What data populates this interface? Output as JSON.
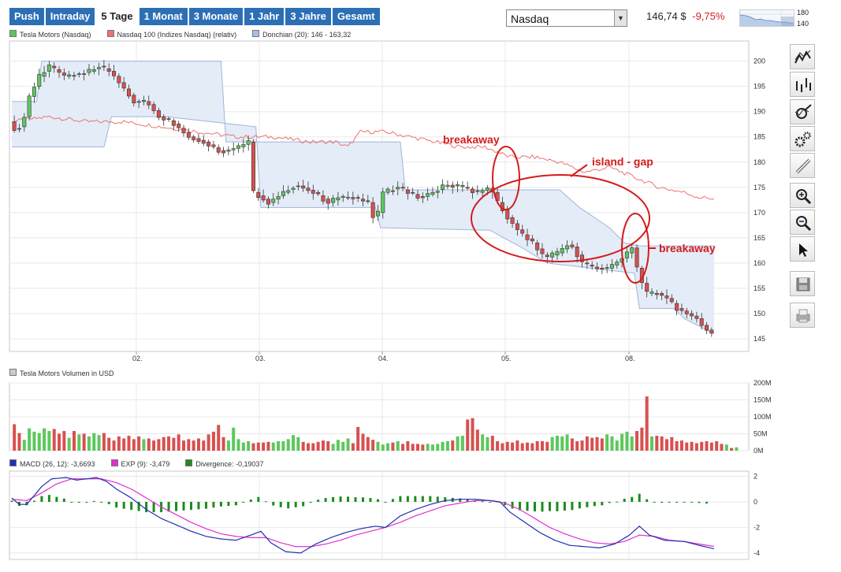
{
  "tabs": [
    {
      "label": "Push",
      "active": false
    },
    {
      "label": "Intraday",
      "active": false
    },
    {
      "label": "5 Tage",
      "active": true
    },
    {
      "label": "1 Monat",
      "active": false
    },
    {
      "label": "3 Monate",
      "active": false
    },
    {
      "label": "1 Jahr",
      "active": false
    },
    {
      "label": "3 Jahre",
      "active": false
    },
    {
      "label": "Gesamt",
      "active": false
    }
  ],
  "exchange_select": {
    "value": "Nasdaq"
  },
  "quote": {
    "price": "146,74 $",
    "change": "-9,75%"
  },
  "mini_chart": {
    "tick_high": "180",
    "tick_low": "140"
  },
  "colors": {
    "up": "#5cc85c",
    "down": "#d85050",
    "index_line": "#f07070",
    "donchian_fill": "#e4ecf8",
    "donchian_line": "#9fb6d8",
    "macd": "#2030b0",
    "signal": "#e030d0",
    "divergence": "#1e8a1e",
    "accent": "#2c6fb5",
    "annotation": "#d41c1c"
  },
  "legend_price": [
    {
      "label": "Tesla Motors (Nasdaq)",
      "color": "#5cc85c"
    },
    {
      "label": "Nasdaq 100 (Indizes Nasdaq) (relativ)",
      "color": "#f07070"
    },
    {
      "label": "Donchian (20): 146 - 163,32",
      "color": "#a9bfe0"
    }
  ],
  "legend_volume": [
    {
      "label": "Tesla Motors Volumen in USD",
      "color": "#cccccc"
    }
  ],
  "legend_macd": [
    {
      "label": "MACD (26, 12): -3,6693",
      "color": "#2030b0"
    },
    {
      "label": "EXP (9): -3,479",
      "color": "#e030d0"
    },
    {
      "label": "Divergence: -0,19037",
      "color": "#1e8a1e"
    }
  ],
  "annotations": {
    "breakaway_1": "breakaway",
    "island_gap": "island - gap",
    "breakaway_2": "breakaway"
  },
  "toolbar": [
    {
      "name": "line-chart-icon"
    },
    {
      "name": "ohlc-chart-icon"
    },
    {
      "name": "indicator-icon"
    },
    {
      "name": "settings-icon"
    },
    {
      "name": "drawing-tool-icon"
    },
    {
      "name": "zoom-in-icon"
    },
    {
      "name": "zoom-out-icon"
    },
    {
      "name": "pointer-icon"
    },
    {
      "name": "save-icon"
    },
    {
      "name": "print-icon"
    }
  ],
  "chart_data": [
    {
      "type": "candlestick",
      "title": "Tesla Motors (Nasdaq)",
      "x_ticks": [
        "02.",
        "03.",
        "04.",
        "05.",
        "08."
      ],
      "y_ticks": [
        145,
        150,
        155,
        160,
        165,
        170,
        175,
        180,
        185,
        190,
        195,
        200
      ],
      "ylim": [
        142.5,
        204
      ],
      "grid": true,
      "price_path": [
        [
          0,
          188
        ],
        [
          3,
          186
        ],
        [
          6,
          189
        ],
        [
          8,
          193
        ],
        [
          12,
          197
        ],
        [
          16,
          199
        ],
        [
          22,
          197
        ],
        [
          28,
          197.5
        ],
        [
          32,
          198
        ],
        [
          36,
          199
        ],
        [
          40,
          198
        ],
        [
          42,
          197
        ],
        [
          50,
          192
        ],
        [
          55,
          192
        ],
        [
          60,
          189
        ],
        [
          65,
          188
        ],
        [
          72,
          185
        ],
        [
          78,
          184
        ],
        [
          85,
          182
        ],
        [
          92,
          183
        ],
        [
          96,
          184
        ],
        [
          98,
          174
        ],
        [
          104,
          172
        ],
        [
          110,
          174
        ],
        [
          115,
          175.5
        ],
        [
          122,
          174
        ],
        [
          128,
          172
        ],
        [
          132,
          173
        ],
        [
          138,
          173
        ],
        [
          144,
          172
        ],
        [
          147,
          168
        ],
        [
          150,
          174
        ],
        [
          156,
          175
        ],
        [
          160,
          174
        ],
        [
          165,
          173
        ],
        [
          170,
          174
        ],
        [
          175,
          175.5
        ],
        [
          182,
          175
        ],
        [
          188,
          174
        ],
        [
          193,
          175
        ],
        [
          196,
          172
        ],
        [
          200,
          169
        ],
        [
          205,
          166
        ],
        [
          210,
          164
        ],
        [
          215,
          161
        ],
        [
          220,
          162
        ],
        [
          225,
          164
        ],
        [
          230,
          160
        ],
        [
          235,
          159
        ],
        [
          240,
          159
        ],
        [
          245,
          160.5
        ],
        [
          250,
          163
        ],
        [
          253,
          157
        ],
        [
          256,
          154
        ],
        [
          260,
          154
        ],
        [
          264,
          153
        ],
        [
          268,
          151
        ],
        [
          272,
          150
        ],
        [
          276,
          149
        ],
        [
          279,
          147
        ],
        [
          282,
          146.2
        ]
      ],
      "index_relative_path": [
        [
          0,
          188
        ],
        [
          15,
          189
        ],
        [
          30,
          188
        ],
        [
          45,
          188
        ],
        [
          60,
          187
        ],
        [
          75,
          186
        ],
        [
          90,
          185
        ],
        [
          105,
          185
        ],
        [
          120,
          184
        ],
        [
          130,
          184
        ],
        [
          135,
          183
        ],
        [
          140,
          186
        ],
        [
          150,
          186
        ],
        [
          160,
          185
        ],
        [
          170,
          184
        ],
        [
          180,
          183
        ],
        [
          190,
          183
        ],
        [
          200,
          181
        ],
        [
          210,
          181
        ],
        [
          220,
          180
        ],
        [
          230,
          178
        ],
        [
          240,
          179
        ],
        [
          250,
          177
        ],
        [
          260,
          175
        ],
        [
          270,
          174
        ],
        [
          276,
          173
        ],
        [
          282,
          172.8
        ]
      ],
      "donchian_upper_path": [
        [
          0,
          192
        ],
        [
          10,
          192
        ],
        [
          12,
          200
        ],
        [
          84,
          200
        ],
        [
          86,
          184
        ],
        [
          156,
          184
        ],
        [
          158,
          174.5
        ],
        [
          220,
          174.5
        ],
        [
          228,
          171
        ],
        [
          240,
          167
        ],
        [
          246,
          164
        ],
        [
          252,
          163.4
        ],
        [
          282,
          163.4
        ]
      ],
      "donchian_lower_path": [
        [
          0,
          183
        ],
        [
          37,
          183
        ],
        [
          40,
          189
        ],
        [
          62,
          189
        ],
        [
          98,
          187
        ],
        [
          100,
          171
        ],
        [
          146,
          171
        ],
        [
          148,
          167
        ],
        [
          192,
          166.5
        ],
        [
          205,
          163
        ],
        [
          215,
          160
        ],
        [
          250,
          158
        ],
        [
          252,
          151
        ],
        [
          266,
          151
        ],
        [
          270,
          149
        ],
        [
          282,
          146
        ]
      ],
      "series": [
        {
          "name": "Tesla Motors (Nasdaq)"
        },
        {
          "name": "Nasdaq 100 (Indizes Nasdaq) (relativ)"
        },
        {
          "name": "Donchian (20): 146 - 163,32"
        }
      ]
    },
    {
      "type": "bar",
      "title": "Tesla Motors Volumen in USD",
      "y_ticks": [
        "0M",
        "50M",
        "100M",
        "150M",
        "200M"
      ],
      "ylim": [
        0,
        200
      ],
      "count": 146,
      "series": [
        {
          "values": [
            78,
            52,
            32,
            66,
            56,
            52,
            66,
            58,
            64,
            50,
            58,
            38,
            58,
            48,
            50,
            42,
            52,
            46,
            52,
            38,
            30,
            42,
            36,
            44,
            34,
            42,
            34,
            36,
            30,
            34,
            40,
            42,
            38,
            48,
            30,
            34,
            30,
            36,
            30,
            48,
            56,
            76,
            40,
            30,
            68,
            34,
            24,
            28,
            22,
            24,
            24,
            26,
            24,
            28,
            28,
            34,
            46,
            40,
            26,
            22,
            22,
            26,
            30,
            28,
            20,
            32,
            26,
            36,
            22,
            70,
            50,
            40,
            32,
            26,
            18,
            22,
            24,
            28,
            20,
            28,
            20,
            20,
            18,
            20,
            18,
            20,
            26,
            28,
            30,
            42,
            44,
            92,
            96,
            62,
            48,
            40,
            44,
            28,
            22,
            26,
            24,
            30,
            22,
            24,
            22,
            28,
            28,
            26,
            40,
            44,
            42,
            48,
            36,
            28,
            30,
            42,
            38,
            40,
            36,
            48,
            42,
            30,
            50,
            56,
            42,
            58,
            68,
            160,
            42,
            44,
            42,
            34,
            40,
            28,
            30,
            24,
            26,
            22,
            26,
            28,
            24,
            28,
            20,
            18,
            8,
            10
          ]
        }
      ]
    },
    {
      "type": "line",
      "title": "MACD",
      "y_ticks": [
        2,
        0,
        -2,
        -4
      ],
      "ylim": [
        -4.5,
        2.4
      ],
      "macd_path": [
        [
          0,
          0.3
        ],
        [
          3,
          -0.2
        ],
        [
          6,
          -0.2
        ],
        [
          9,
          0.5
        ],
        [
          12,
          1.2
        ],
        [
          16,
          1.8
        ],
        [
          22,
          1.9
        ],
        [
          26,
          1.7
        ],
        [
          30,
          1.8
        ],
        [
          34,
          1.9
        ],
        [
          38,
          1.6
        ],
        [
          42,
          1.0
        ],
        [
          48,
          0.3
        ],
        [
          54,
          -0.6
        ],
        [
          60,
          -1.3
        ],
        [
          66,
          -1.8
        ],
        [
          72,
          -2.3
        ],
        [
          78,
          -2.7
        ],
        [
          84,
          -2.9
        ],
        [
          90,
          -3.0
        ],
        [
          96,
          -2.6
        ],
        [
          100,
          -2.3
        ],
        [
          104,
          -3.2
        ],
        [
          110,
          -3.9
        ],
        [
          116,
          -4.0
        ],
        [
          122,
          -3.3
        ],
        [
          128,
          -2.8
        ],
        [
          134,
          -2.4
        ],
        [
          140,
          -2.1
        ],
        [
          146,
          -1.9
        ],
        [
          150,
          -2.0
        ],
        [
          156,
          -1.1
        ],
        [
          162,
          -0.6
        ],
        [
          168,
          -0.2
        ],
        [
          174,
          0.1
        ],
        [
          180,
          0.2
        ],
        [
          186,
          0.2
        ],
        [
          192,
          0.1
        ],
        [
          196,
          0.0
        ],
        [
          200,
          -0.8
        ],
        [
          206,
          -1.6
        ],
        [
          212,
          -2.4
        ],
        [
          218,
          -3.0
        ],
        [
          224,
          -3.4
        ],
        [
          230,
          -3.5
        ],
        [
          236,
          -3.6
        ],
        [
          242,
          -3.3
        ],
        [
          248,
          -2.6
        ],
        [
          252,
          -1.9
        ],
        [
          256,
          -2.6
        ],
        [
          262,
          -3.0
        ],
        [
          270,
          -3.1
        ],
        [
          276,
          -3.4
        ],
        [
          282,
          -3.67
        ]
      ],
      "signal_path": [
        [
          0,
          0.2
        ],
        [
          6,
          0.1
        ],
        [
          12,
          0.7
        ],
        [
          18,
          1.4
        ],
        [
          24,
          1.8
        ],
        [
          30,
          1.8
        ],
        [
          36,
          1.8
        ],
        [
          42,
          1.5
        ],
        [
          48,
          1.0
        ],
        [
          54,
          0.3
        ],
        [
          60,
          -0.4
        ],
        [
          66,
          -1.0
        ],
        [
          72,
          -1.6
        ],
        [
          78,
          -2.1
        ],
        [
          84,
          -2.5
        ],
        [
          90,
          -2.7
        ],
        [
          96,
          -2.8
        ],
        [
          102,
          -2.8
        ],
        [
          108,
          -3.2
        ],
        [
          114,
          -3.5
        ],
        [
          120,
          -3.5
        ],
        [
          126,
          -3.3
        ],
        [
          132,
          -3.0
        ],
        [
          138,
          -2.6
        ],
        [
          144,
          -2.3
        ],
        [
          150,
          -2.0
        ],
        [
          156,
          -1.6
        ],
        [
          162,
          -1.1
        ],
        [
          168,
          -0.7
        ],
        [
          174,
          -0.3
        ],
        [
          180,
          -0.1
        ],
        [
          186,
          0.1
        ],
        [
          192,
          0.1
        ],
        [
          198,
          -0.1
        ],
        [
          204,
          -0.6
        ],
        [
          210,
          -1.3
        ],
        [
          216,
          -2.0
        ],
        [
          222,
          -2.5
        ],
        [
          228,
          -2.9
        ],
        [
          234,
          -3.2
        ],
        [
          240,
          -3.3
        ],
        [
          246,
          -3.1
        ],
        [
          252,
          -2.6
        ],
        [
          258,
          -2.7
        ],
        [
          264,
          -3.0
        ],
        [
          270,
          -3.1
        ],
        [
          276,
          -3.3
        ],
        [
          282,
          -3.48
        ]
      ],
      "series": [
        {
          "name": "MACD (26, 12): -3,6693"
        },
        {
          "name": "EXP (9): -3,479"
        },
        {
          "name": "Divergence: -0,19037"
        }
      ]
    }
  ]
}
